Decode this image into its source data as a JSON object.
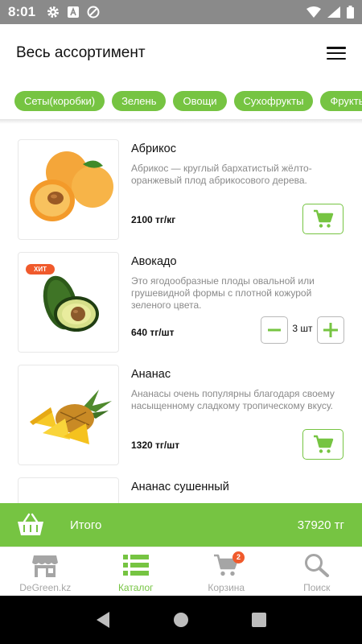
{
  "status_bar": {
    "time": "8:01"
  },
  "header": {
    "title": "Весь ассортимент"
  },
  "categories": [
    "Сеты(коробки)",
    "Зелень",
    "Овощи",
    "Сухофрукты",
    "Фрукты"
  ],
  "products": [
    {
      "name": "Абрикос",
      "description": "Абрикос — круглый бархатистый жёлто-оранжевый плод абрикосового дерева.",
      "price": "2100 тг/кг"
    },
    {
      "name": "Авокадо",
      "badge": "ХИТ",
      "description": "Это ягодообразные плоды овальной или грушевидной формы с плотной кожурой зеленого цвета.",
      "price": "640 тг/шт",
      "quantity": "3 шт"
    },
    {
      "name": "Ананас",
      "description": "Ананасы очень популярны благодаря своему насыщенному сладкому тропическому вкусу.",
      "price": "1320 тг/шт"
    },
    {
      "name": "Ананас сушенный"
    }
  ],
  "total": {
    "label": "Итого",
    "value": "37920 тг"
  },
  "bottom_nav": [
    {
      "label": "DeGreen.kz",
      "icon": "store-icon"
    },
    {
      "label": "Каталог",
      "icon": "list-icon",
      "active": true
    },
    {
      "label": "Корзина",
      "icon": "cart-icon",
      "badge": "2"
    },
    {
      "label": "Поиск",
      "icon": "search-icon"
    }
  ],
  "colors": {
    "accent": "#76c442",
    "badge": "#f05a2c",
    "status_bar": "#8a8a8a",
    "inactive": "#a5a5a5"
  }
}
